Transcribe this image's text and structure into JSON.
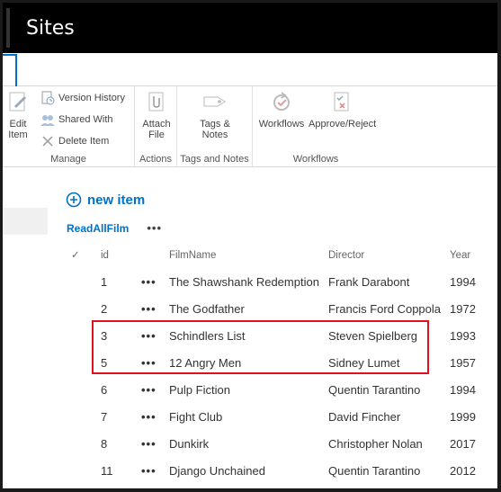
{
  "suite": {
    "title": "Sites"
  },
  "ribbon": {
    "manage": {
      "edit_item": "Edit\nItem",
      "version_history": "Version History",
      "shared_with": "Shared With",
      "delete_item": "Delete Item",
      "label": "Manage"
    },
    "actions": {
      "attach_file": "Attach\nFile",
      "label": "Actions"
    },
    "tags": {
      "tags_notes": "Tags &\nNotes",
      "label": "Tags and Notes"
    },
    "workflows": {
      "workflows": "Workflows",
      "approve_reject": "Approve/Reject",
      "label": "Workflows"
    }
  },
  "list": {
    "new_item": "new item",
    "view_name": "ReadAllFilm",
    "view_more": "•••",
    "columns": {
      "check": "✓",
      "id": "id",
      "film": "FilmName",
      "director": "Director",
      "year": "Year"
    },
    "rows": [
      {
        "id": "1",
        "dots": "•••",
        "film": "The Shawshank Redemption",
        "director": "Frank Darabont",
        "year": "1994"
      },
      {
        "id": "2",
        "dots": "•••",
        "film": "The Godfather",
        "director": "Francis Ford Coppola",
        "year": "1972"
      },
      {
        "id": "3",
        "dots": "•••",
        "film": "Schindlers List",
        "director": "Steven Spielberg",
        "year": "1993"
      },
      {
        "id": "5",
        "dots": "•••",
        "film": "12 Angry Men",
        "director": "Sidney Lumet",
        "year": "1957"
      },
      {
        "id": "6",
        "dots": "•••",
        "film": "Pulp Fiction",
        "director": "Quentin Tarantino",
        "year": "1994"
      },
      {
        "id": "7",
        "dots": "•••",
        "film": "Fight Club",
        "director": "David Fincher",
        "year": "1999"
      },
      {
        "id": "8",
        "dots": "•••",
        "film": "Dunkirk",
        "director": "Christopher Nolan",
        "year": "2017"
      },
      {
        "id": "11",
        "dots": "•••",
        "film": "Django Unchained",
        "director": "Quentin Tarantino",
        "year": "2012"
      }
    ]
  },
  "colors": {
    "accent": "#0072c6",
    "highlight": "#e0101f",
    "suitebar": "#000000"
  }
}
